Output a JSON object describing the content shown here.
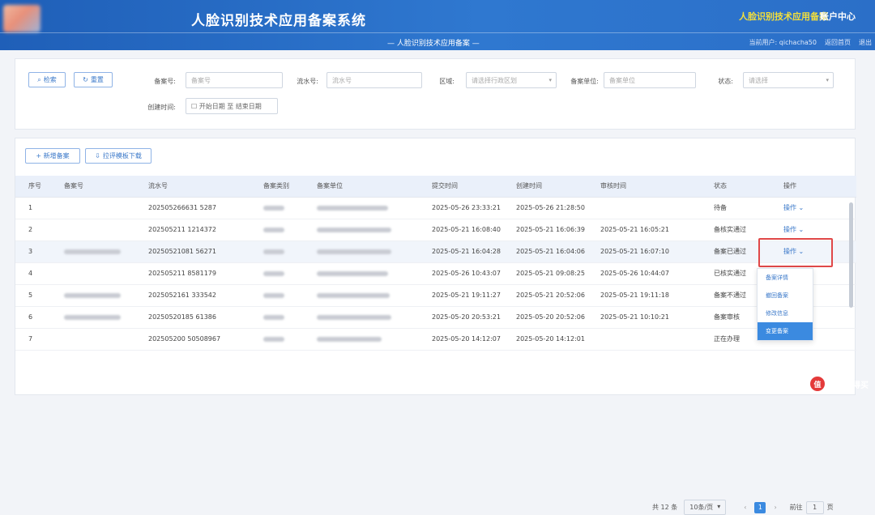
{
  "header": {
    "system_title": "人脸识别技术应用备案系统",
    "right_title": "人脸识别技术应用备案",
    "account": "账户中心",
    "subtitle": "— 人脸识别技术应用备案 —",
    "user_label": "当前用户:",
    "user_name": "qichacha50",
    "back_home": "返回首页",
    "logout": "退出"
  },
  "search": {
    "search_button": "检索",
    "reset_button": "重置",
    "filing_no_label": "备案号:",
    "filing_no_placeholder": "备案号",
    "process_no_label": "流水号:",
    "process_no_placeholder": "流水号",
    "region_label": "区域:",
    "region_placeholder": "请选择行政区划",
    "unit_label": "备案单位:",
    "unit_placeholder": "备案单位",
    "status_label": "状态:",
    "status_placeholder": "请选择",
    "date_label": "创建时间:",
    "date_start": "开始日期",
    "date_sep": "至",
    "date_end": "结束日期"
  },
  "toolbar": {
    "new_filing": "+ 新增备案",
    "download_template": "拉评模板下载"
  },
  "table": {
    "columns": [
      "序号",
      "备案号",
      "流水号",
      "备案类别",
      "备案单位",
      "提交时间",
      "创建时间",
      "审核时间",
      "状态",
      "操作"
    ],
    "rows": [
      {
        "idx": "1",
        "process_no": "202505266631 5287",
        "submit": "2025-05-26 23:33:21",
        "created": "2025-05-26 21:28:50",
        "review": "",
        "status": "待备",
        "op": "操作"
      },
      {
        "idx": "2",
        "process_no": "202505211 1214372",
        "submit": "2025-05-21 16:08:40",
        "created": "2025-05-21 16:06:39",
        "review": "2025-05-21 16:05:21",
        "status": "备核实通过",
        "op": "操作"
      },
      {
        "idx": "3",
        "process_no": "20250521081 56271",
        "submit": "2025-05-21 16:04:28",
        "created": "2025-05-21 16:04:06",
        "review": "2025-05-21 16:07:10",
        "status": "备案已通过",
        "op": "操作"
      },
      {
        "idx": "4",
        "process_no": "202505211 8581179",
        "submit": "2025-05-26 10:43:07",
        "created": "2025-05-21 09:08:25",
        "review": "2025-05-26 10:44:07",
        "status": "已核实通过",
        "op": ""
      },
      {
        "idx": "5",
        "process_no": "2025052161 333542",
        "submit": "2025-05-21 19:11:27",
        "created": "2025-05-21 20:52:06",
        "review": "2025-05-21 19:11:18",
        "status": "备案不通过",
        "op": ""
      },
      {
        "idx": "6",
        "process_no": "20250520185 61386",
        "submit": "2025-05-20 20:53:21",
        "created": "2025-05-20 20:52:06",
        "review": "2025-05-21 10:10:21",
        "status": "备案审核",
        "op": ""
      },
      {
        "idx": "7",
        "process_no": "202505200 50508967",
        "submit": "2025-05-20 14:12:07",
        "created": "2025-05-20 14:12:01",
        "review": "",
        "status": "正在办理",
        "op": ""
      }
    ]
  },
  "dropdown": {
    "items": [
      "备案详情",
      "撤回备案",
      "修改信息",
      "变更备案"
    ]
  },
  "pagination": {
    "total": "共 12 条",
    "page_size": "10条/页",
    "current_page": "1",
    "goto_label": "前往",
    "goto_value": "1",
    "goto_suffix": "页"
  },
  "watermark": {
    "site": "什么值得买"
  }
}
